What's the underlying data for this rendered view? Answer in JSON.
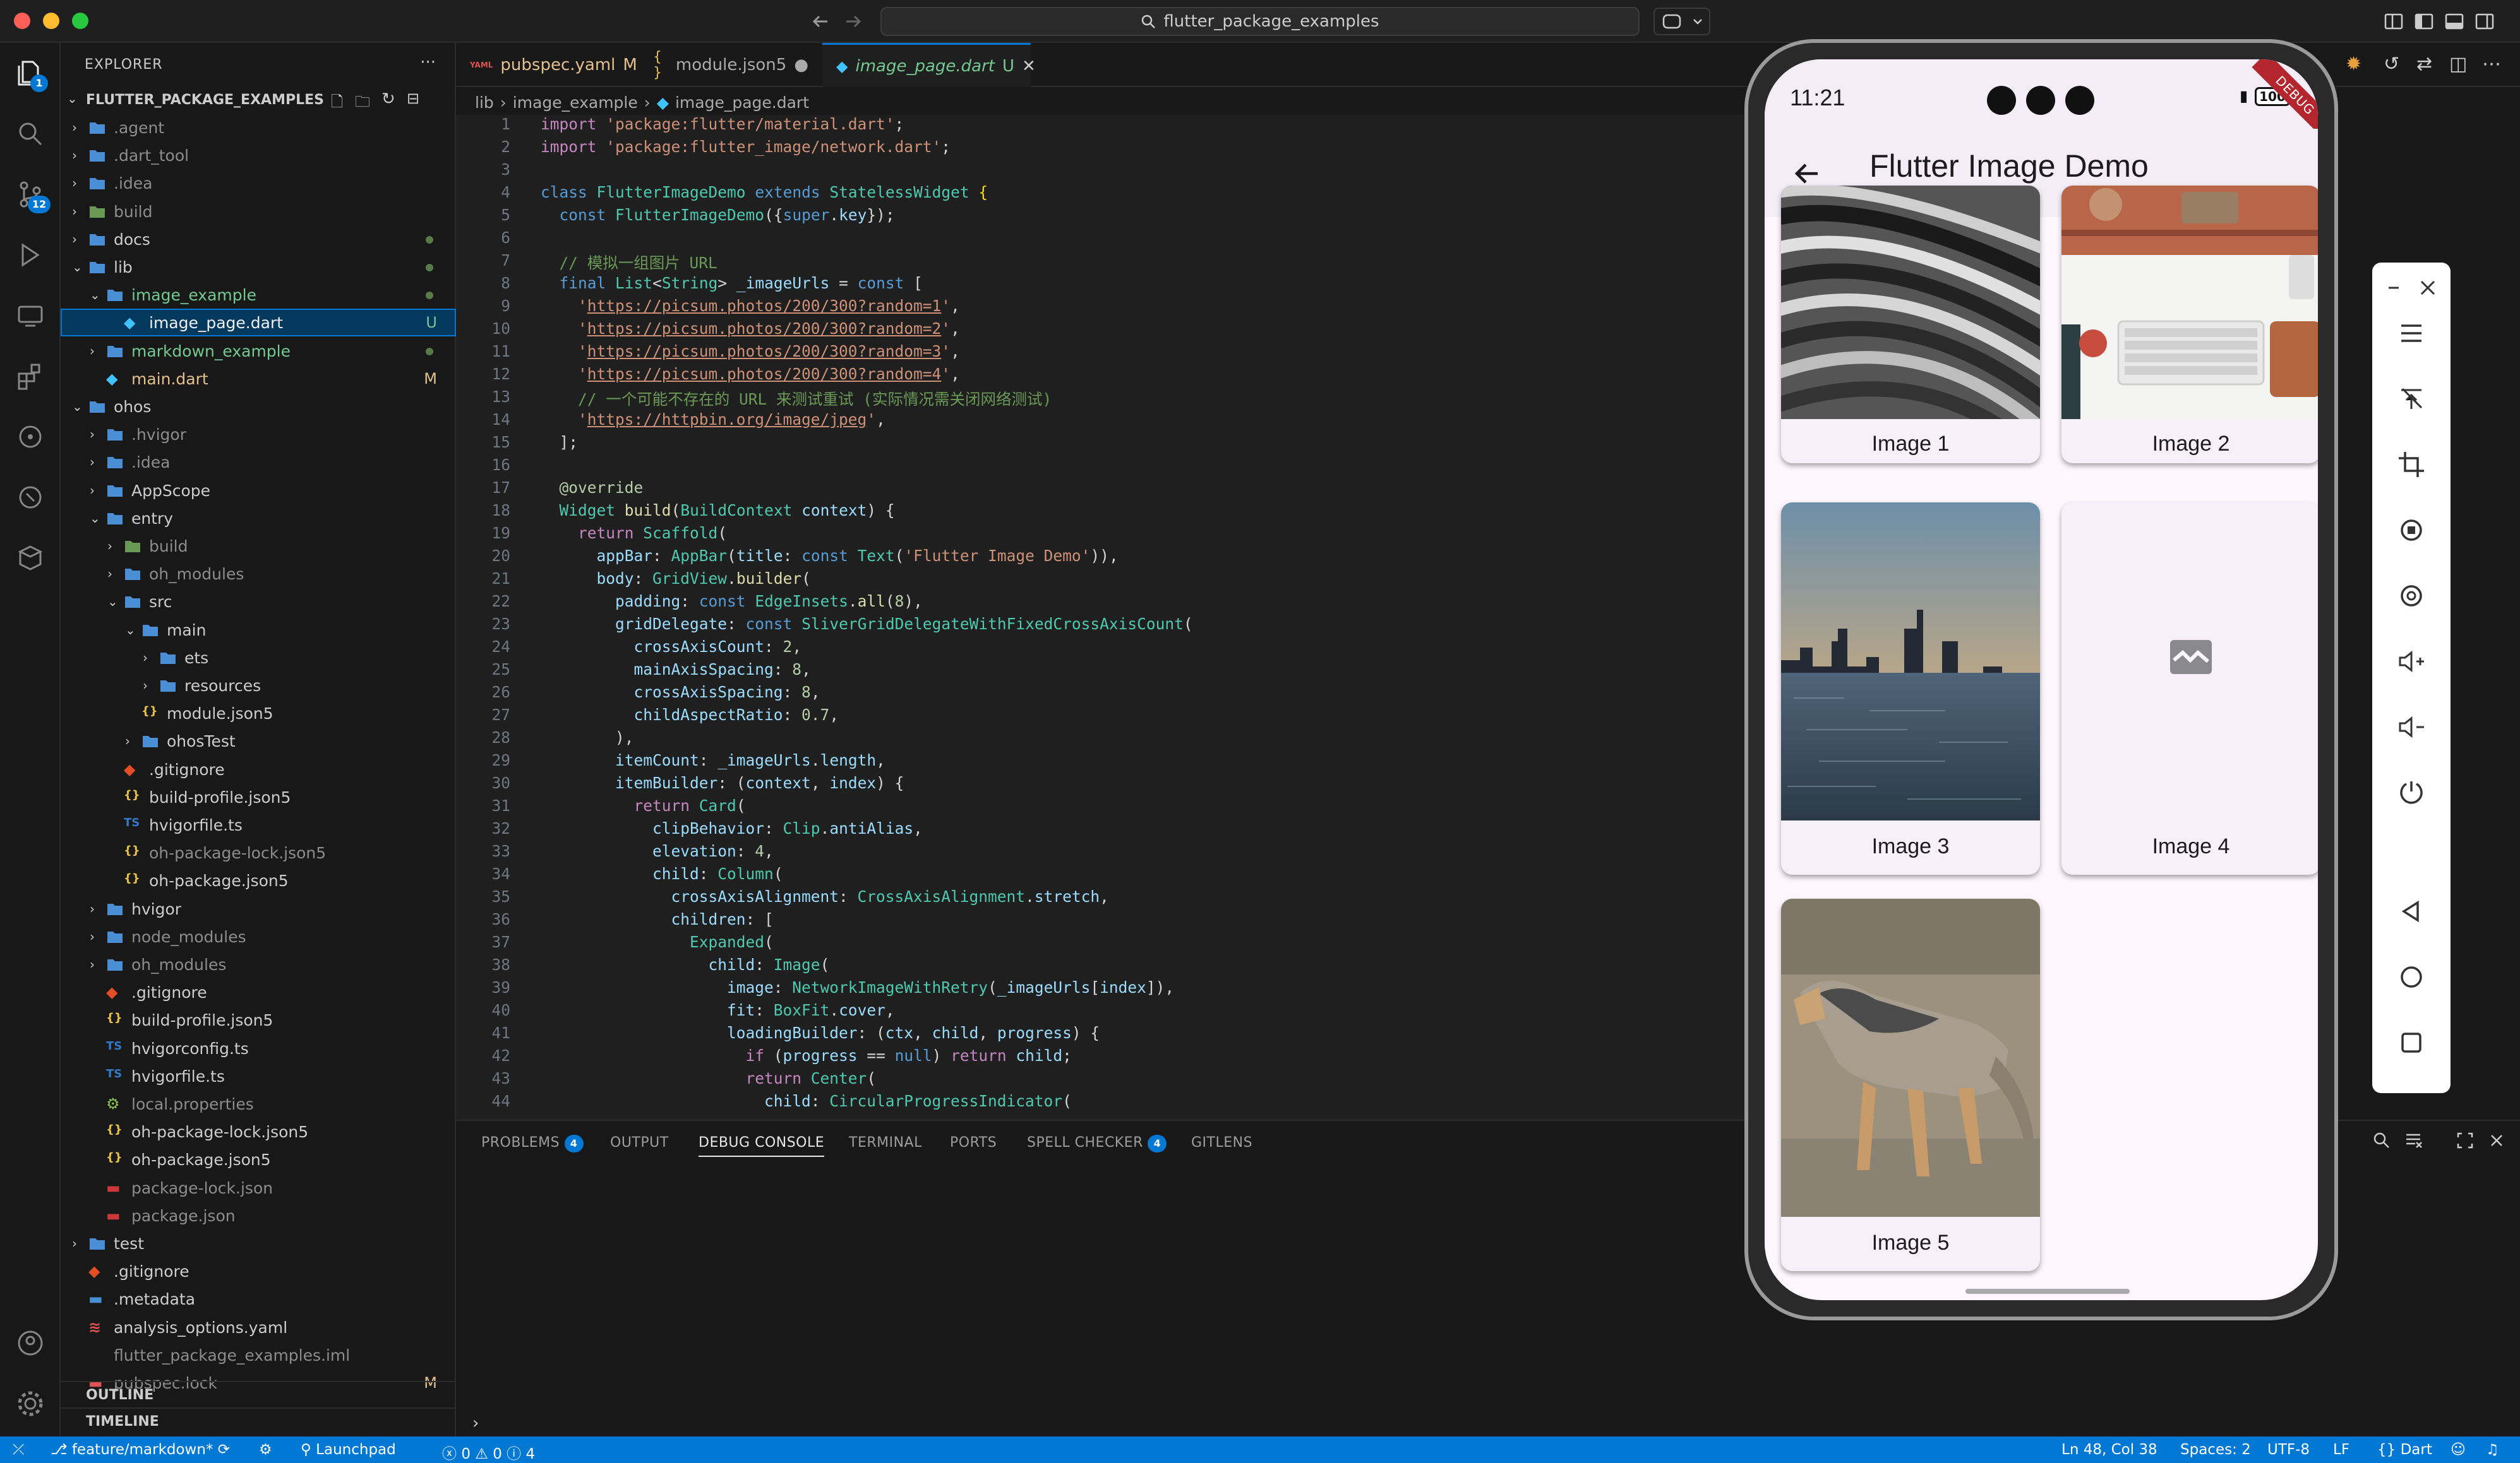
{
  "titlebar": {
    "search": "flutter_package_examples"
  },
  "activity": {
    "explorer_badge": "1",
    "scm_badge": "12"
  },
  "sidebar": {
    "title": "EXPLORER",
    "more": "···",
    "root": "FLUTTER_PACKAGE_EXAMPLES",
    "items": [
      {
        "label": ".agent",
        "status": ""
      },
      {
        "label": ".dart_tool",
        "status": ""
      },
      {
        "label": ".idea",
        "status": ""
      },
      {
        "label": "build",
        "status": ""
      },
      {
        "label": "docs",
        "status": ""
      },
      {
        "label": "lib",
        "status": ""
      },
      {
        "label": "image_example",
        "status": ""
      },
      {
        "label": "image_page.dart",
        "status": "U"
      },
      {
        "label": "markdown_example",
        "status": ""
      },
      {
        "label": "main.dart",
        "status": "M"
      },
      {
        "label": "ohos",
        "status": ""
      },
      {
        "label": ".hvigor",
        "status": ""
      },
      {
        "label": ".idea",
        "status": ""
      },
      {
        "label": "AppScope",
        "status": ""
      },
      {
        "label": "entry",
        "status": ""
      },
      {
        "label": "build",
        "status": ""
      },
      {
        "label": "oh_modules",
        "status": ""
      },
      {
        "label": "src",
        "status": ""
      },
      {
        "label": "main",
        "status": ""
      },
      {
        "label": "ets",
        "status": ""
      },
      {
        "label": "resources",
        "status": ""
      },
      {
        "label": "module.json5",
        "status": ""
      },
      {
        "label": "ohosTest",
        "status": ""
      },
      {
        "label": ".gitignore",
        "status": ""
      },
      {
        "label": "build-profile.json5",
        "status": ""
      },
      {
        "label": "hvigorfile.ts",
        "status": ""
      },
      {
        "label": "oh-package-lock.json5",
        "status": ""
      },
      {
        "label": "oh-package.json5",
        "status": ""
      },
      {
        "label": "hvigor",
        "status": ""
      },
      {
        "label": "node_modules",
        "status": ""
      },
      {
        "label": "oh_modules",
        "status": ""
      },
      {
        "label": ".gitignore",
        "status": ""
      },
      {
        "label": "build-profile.json5",
        "status": ""
      },
      {
        "label": "hvigorconfig.ts",
        "status": ""
      },
      {
        "label": "hvigorfile.ts",
        "status": ""
      },
      {
        "label": "local.properties",
        "status": ""
      },
      {
        "label": "oh-package-lock.json5",
        "status": ""
      },
      {
        "label": "oh-package.json5",
        "status": ""
      },
      {
        "label": "package-lock.json",
        "status": ""
      },
      {
        "label": "package.json",
        "status": ""
      },
      {
        "label": "test",
        "status": ""
      },
      {
        "label": ".gitignore",
        "status": ""
      },
      {
        "label": ".metadata",
        "status": ""
      },
      {
        "label": "analysis_options.yaml",
        "status": ""
      },
      {
        "label": "flutter_package_examples.iml",
        "status": ""
      },
      {
        "label": "pubspec.lock",
        "status": "M"
      }
    ],
    "outline": "OUTLINE",
    "timeline": "TIMELINE"
  },
  "tabs": [
    {
      "label": "pubspec.yaml",
      "status": "M"
    },
    {
      "label": "module.json5",
      "status": "●"
    },
    {
      "label": "image_page.dart",
      "status": "U"
    }
  ],
  "breadcrumb": [
    "lib",
    "image_example",
    "image_page.dart"
  ],
  "code": [
    "1",
    "2",
    "3",
    "4",
    "5",
    "6",
    "7",
    "8",
    "9",
    "10",
    "11",
    "12",
    "13",
    "14",
    "15",
    "16",
    "17",
    "18",
    "19",
    "20",
    "21",
    "22",
    "23",
    "24",
    "25",
    "26",
    "27",
    "28",
    "29",
    "30",
    "31",
    "32",
    "33",
    "34",
    "35",
    "36",
    "37",
    "38",
    "39",
    "40",
    "41",
    "42",
    "43",
    "44"
  ],
  "panel": {
    "tabs": [
      "PROBLEMS",
      "OUTPUT",
      "DEBUG CONSOLE",
      "TERMINAL",
      "PORTS",
      "SPELL CHECKER",
      "GITLENS"
    ],
    "problems_badge": "4",
    "spell_badge": "4"
  },
  "status": {
    "branch": "feature/markdown*",
    "launchpad": "Launchpad",
    "errors": "0",
    "warnings": "0",
    "infos": "4",
    "position": "Ln 48, Col 38",
    "spaces": "Spaces: 2",
    "encoding": "UTF-8",
    "eol": "LF",
    "language": "Dart"
  },
  "phone": {
    "time": "11:21",
    "battery": "100",
    "debug": "DEBUG",
    "title": "Flutter Image Demo",
    "cards": [
      "Image 1",
      "Image 2",
      "Image 3",
      "Image 4",
      "Image 5"
    ]
  }
}
